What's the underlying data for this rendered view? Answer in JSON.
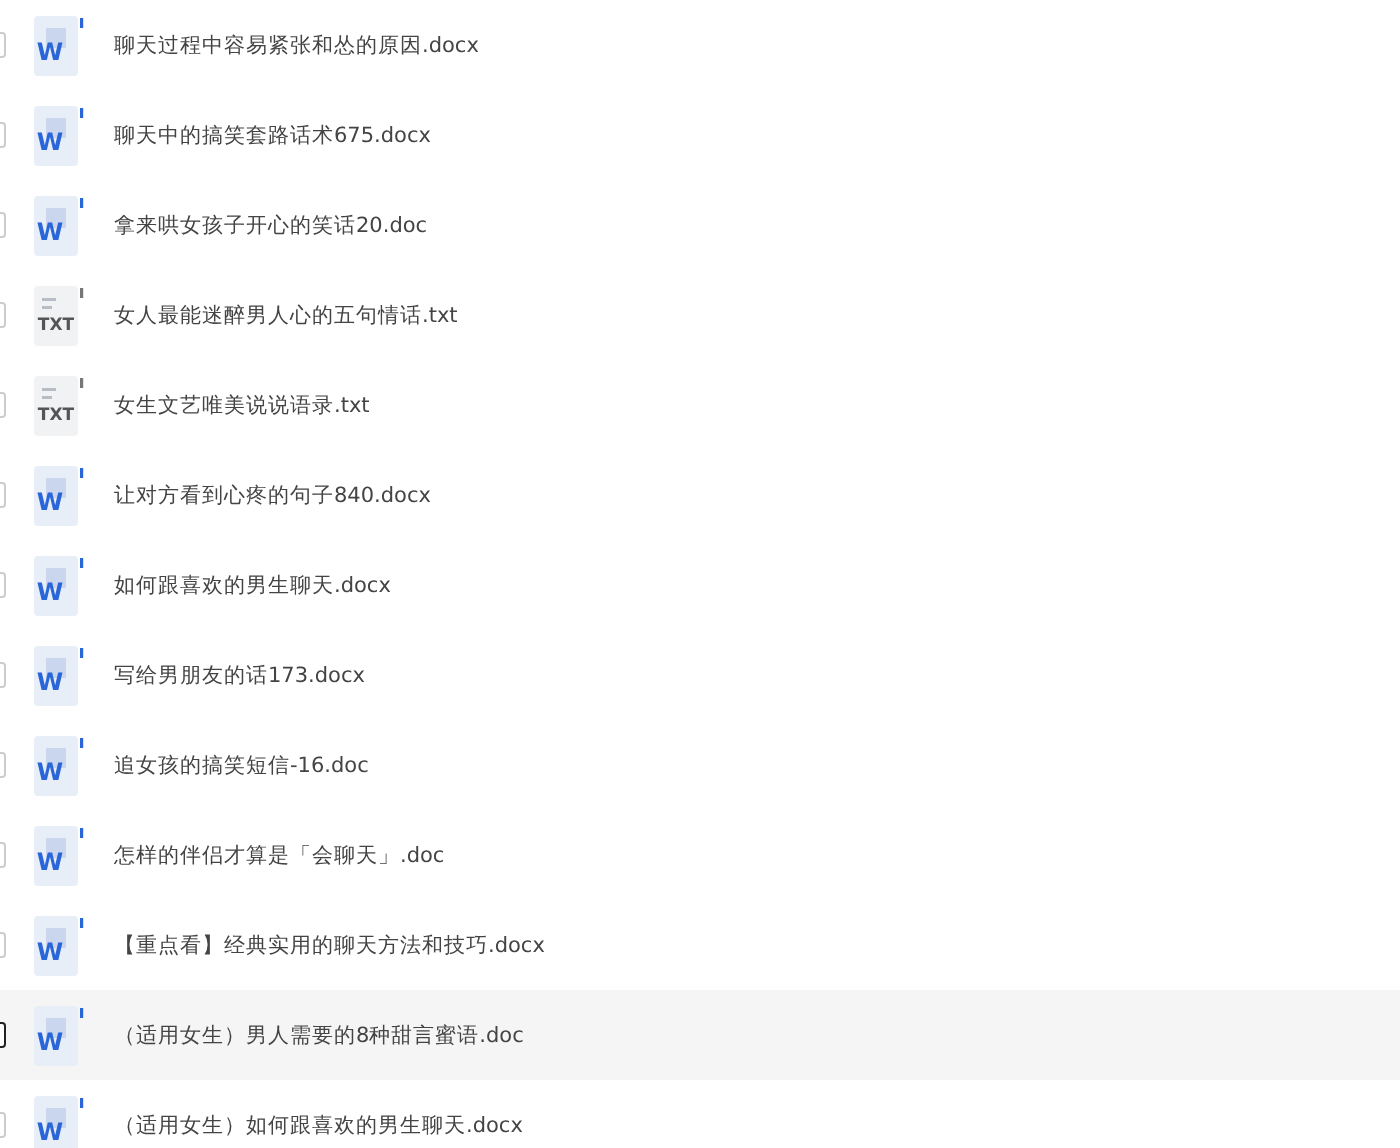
{
  "files": [
    {
      "name": "聊天过程中容易紧张和怂的原因.docx",
      "kind": "word",
      "icon_label": "W",
      "hovered": false
    },
    {
      "name": "聊天中的搞笑套路话术675.docx",
      "kind": "word",
      "icon_label": "W",
      "hovered": false
    },
    {
      "name": "拿来哄女孩子开心的笑话20.doc",
      "kind": "word",
      "icon_label": "W",
      "hovered": false
    },
    {
      "name": "女人最能迷醉男人心的五句情话.txt",
      "kind": "txt",
      "icon_label": "TXT",
      "hovered": false
    },
    {
      "name": "女生文艺唯美说说语录.txt",
      "kind": "txt",
      "icon_label": "TXT",
      "hovered": false
    },
    {
      "name": "让对方看到心疼的句子840.docx",
      "kind": "word",
      "icon_label": "W",
      "hovered": false
    },
    {
      "name": "如何跟喜欢的男生聊天.docx",
      "kind": "word",
      "icon_label": "W",
      "hovered": false
    },
    {
      "name": "写给男朋友的话173.docx",
      "kind": "word",
      "icon_label": "W",
      "hovered": false
    },
    {
      "name": "追女孩的搞笑短信-16.doc",
      "kind": "word",
      "icon_label": "W",
      "hovered": false
    },
    {
      "name": "怎样的伴侣才算是「会聊天」.doc",
      "kind": "word",
      "icon_label": "W",
      "hovered": false
    },
    {
      "name": "【重点看】经典实用的聊天方法和技巧.docx",
      "kind": "word",
      "icon_label": "W",
      "hovered": false
    },
    {
      "name": "（适用女生）男人需要的8种甜言蜜语.doc",
      "kind": "word",
      "icon_label": "W",
      "hovered": true
    },
    {
      "name": "（适用女生）如何跟喜欢的男生聊天.docx",
      "kind": "word",
      "icon_label": "W",
      "hovered": false
    }
  ]
}
